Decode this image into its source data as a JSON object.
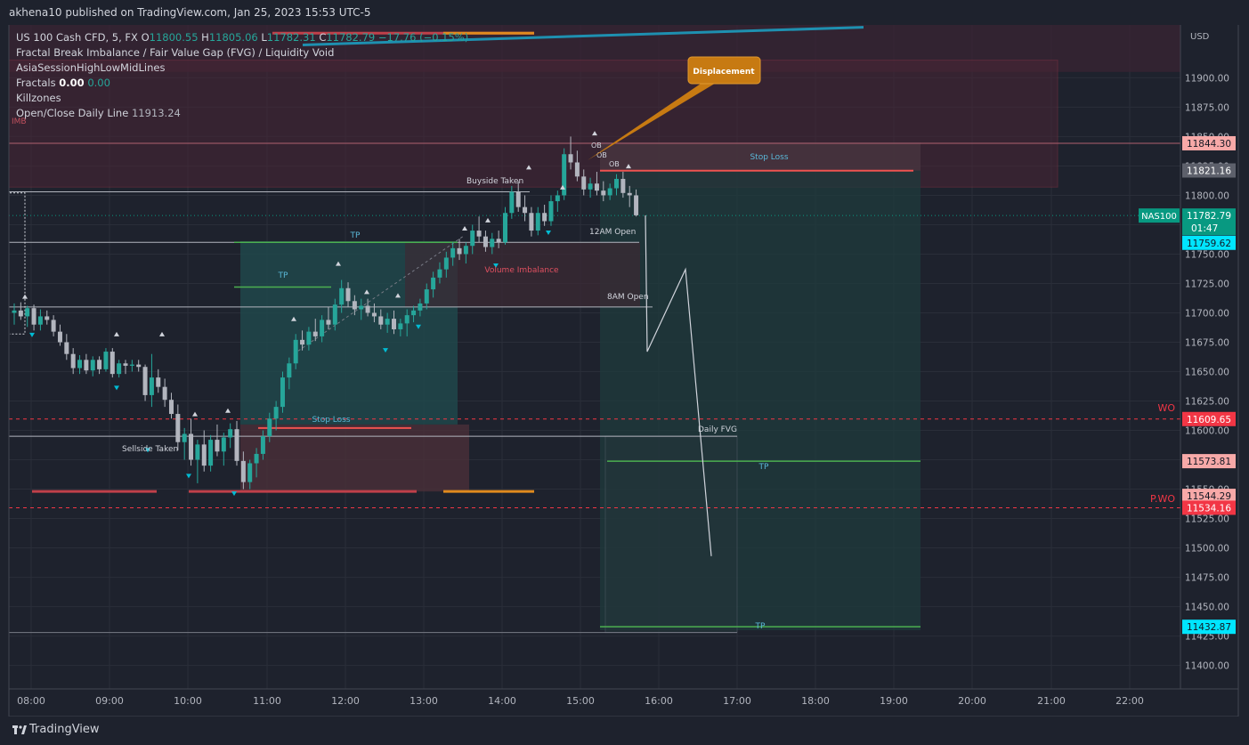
{
  "publisher": "akhena10 published on TradingView.com, Jan 25, 2023 15:53 UTC-5",
  "brand": "TradingView",
  "currency": "USD",
  "legend": {
    "symbol": "US 100 Cash CFD, 5, FX",
    "o_label": "O",
    "o": "11800.55",
    "h_label": "H",
    "h": "11805.06",
    "l_label": "L",
    "l": "11782.31",
    "c_label": "C",
    "c": "11782.79",
    "change": "−17.76 (−0.15%)",
    "ind1": "Fractal Break Imbalance / Fair Value Gap (FVG) / Liquidity Void",
    "ind2": "AsiaSessionHighLowMidLines",
    "ind3": "Fractals",
    "ind3_v1": "0.00",
    "ind3_v2": "0.00",
    "ind4": "Killzones",
    "ind5": "Open/Close Daily Line",
    "ind5_v": "11913.24"
  },
  "colors": {
    "bg": "#1e222d",
    "up": "#26a69a",
    "down": "#ef5350",
    "grid": "#2a2e39",
    "text": "#d1d4dc"
  },
  "chart_data": {
    "type": "candlestick",
    "x_tick_labels": [
      "08:00",
      "09:00",
      "10:00",
      "11:00",
      "12:00",
      "13:00",
      "14:00",
      "15:00",
      "16:00",
      "17:00",
      "18:00",
      "19:00",
      "20:00",
      "21:00",
      "22:00"
    ],
    "y_tick_labels": [
      11400,
      11425,
      11450,
      11475,
      11500,
      11525,
      11550,
      11575,
      11600,
      11625,
      11650,
      11675,
      11700,
      11725,
      11750,
      11775,
      11800,
      11825,
      11850,
      11875,
      11900
    ],
    "ylim": [
      11380,
      11945
    ],
    "price_badges": [
      {
        "label": "11844.30",
        "price": 11844.3,
        "color": "#f7a9a8",
        "text": "#131722"
      },
      {
        "label": "11821.16",
        "price": 11821.16,
        "color": "#5d606b",
        "text": "#ffffff"
      },
      {
        "label": "11782.79",
        "sub": "01:47",
        "price": 11782.79,
        "color": "#089981",
        "text": "#ffffff"
      },
      {
        "label": "11759.62",
        "price": 11759.62,
        "color": "#00e5ff",
        "text": "#131722"
      },
      {
        "label": "11609.65",
        "price": 11609.65,
        "color": "#f23645",
        "text": "#ffffff"
      },
      {
        "label": "11573.81",
        "price": 11573.81,
        "color": "#f7a9a8",
        "text": "#131722"
      },
      {
        "label": "11544.29",
        "price": 11544.29,
        "color": "#f7a9a8",
        "text": "#131722"
      },
      {
        "label": "11534.16",
        "price": 11534.16,
        "color": "#f23645",
        "text": "#ffffff"
      },
      {
        "label": "11432.87",
        "price": 11432.87,
        "color": "#00e5ff",
        "text": "#131722"
      }
    ],
    "symbol_tag": "NAS100",
    "annotations": [
      {
        "text": "Displacement"
      },
      {
        "text": "Stop Loss"
      },
      {
        "text": "TP"
      },
      {
        "text": "TP"
      },
      {
        "text": "Stop Loss"
      },
      {
        "text": "TP"
      },
      {
        "text": "TP"
      },
      {
        "text": "Buyside Taken"
      },
      {
        "text": "Sellside Taken"
      },
      {
        "text": "12AM Open"
      },
      {
        "text": "8AM Open"
      },
      {
        "text": "Volume Imbalance"
      },
      {
        "text": "Daily FVG"
      },
      {
        "text": "IMB"
      },
      {
        "text": "WO"
      },
      {
        "text": "P.WO"
      },
      {
        "text": "OB"
      },
      {
        "text": "OB"
      },
      {
        "text": "OB"
      }
    ],
    "candles": [
      [
        11700,
        11708,
        11690,
        11702
      ],
      [
        11702,
        11709,
        11694,
        11697
      ],
      [
        11697,
        11706,
        11688,
        11704
      ],
      [
        11704,
        11707,
        11685,
        11690
      ],
      [
        11690,
        11703,
        11685,
        11697
      ],
      [
        11697,
        11702,
        11690,
        11694
      ],
      [
        11694,
        11698,
        11680,
        11684
      ],
      [
        11684,
        11690,
        11672,
        11675
      ],
      [
        11675,
        11682,
        11660,
        11665
      ],
      [
        11665,
        11670,
        11648,
        11653
      ],
      [
        11653,
        11664,
        11648,
        11660
      ],
      [
        11660,
        11665,
        11648,
        11651
      ],
      [
        11651,
        11663,
        11646,
        11660
      ],
      [
        11660,
        11663,
        11648,
        11652
      ],
      [
        11652,
        11670,
        11650,
        11667
      ],
      [
        11667,
        11670,
        11645,
        11648
      ],
      [
        11648,
        11660,
        11645,
        11657
      ],
      [
        11657,
        11660,
        11648,
        11655
      ],
      [
        11655,
        11660,
        11650,
        11656
      ],
      [
        11656,
        11660,
        11650,
        11654
      ],
      [
        11654,
        11656,
        11625,
        11630
      ],
      [
        11630,
        11665,
        11620,
        11645
      ],
      [
        11645,
        11652,
        11632,
        11637
      ],
      [
        11637,
        11644,
        11620,
        11626
      ],
      [
        11626,
        11632,
        11610,
        11614
      ],
      [
        11614,
        11622,
        11583,
        11590
      ],
      [
        11590,
        11602,
        11575,
        11597
      ],
      [
        11597,
        11610,
        11570,
        11575
      ],
      [
        11575,
        11592,
        11555,
        11588
      ],
      [
        11588,
        11600,
        11565,
        11570
      ],
      [
        11570,
        11596,
        11565,
        11592
      ],
      [
        11592,
        11605,
        11578,
        11582
      ],
      [
        11582,
        11598,
        11570,
        11594
      ],
      [
        11594,
        11606,
        11585,
        11601
      ],
      [
        11601,
        11608,
        11570,
        11574
      ],
      [
        11574,
        11582,
        11550,
        11556
      ],
      [
        11556,
        11575,
        11550,
        11572
      ],
      [
        11572,
        11585,
        11560,
        11580
      ],
      [
        11580,
        11600,
        11575,
        11595
      ],
      [
        11595,
        11615,
        11590,
        11610
      ],
      [
        11610,
        11625,
        11600,
        11620
      ],
      [
        11620,
        11650,
        11615,
        11645
      ],
      [
        11645,
        11662,
        11635,
        11657
      ],
      [
        11657,
        11682,
        11652,
        11677
      ],
      [
        11677,
        11685,
        11668,
        11673
      ],
      [
        11673,
        11688,
        11668,
        11684
      ],
      [
        11684,
        11695,
        11676,
        11680
      ],
      [
        11680,
        11698,
        11675,
        11694
      ],
      [
        11694,
        11705,
        11686,
        11690
      ],
      [
        11690,
        11712,
        11685,
        11707
      ],
      [
        11707,
        11728,
        11700,
        11721
      ],
      [
        11721,
        11726,
        11705,
        11710
      ],
      [
        11710,
        11715,
        11698,
        11703
      ],
      [
        11703,
        11712,
        11694,
        11706
      ],
      [
        11706,
        11712,
        11697,
        11700
      ],
      [
        11700,
        11708,
        11692,
        11697
      ],
      [
        11697,
        11703,
        11686,
        11690
      ],
      [
        11690,
        11700,
        11683,
        11695
      ],
      [
        11695,
        11702,
        11682,
        11686
      ],
      [
        11686,
        11695,
        11680,
        11691
      ],
      [
        11691,
        11703,
        11680,
        11698
      ],
      [
        11698,
        11706,
        11692,
        11702
      ],
      [
        11702,
        11712,
        11697,
        11708
      ],
      [
        11708,
        11725,
        11703,
        11720
      ],
      [
        11720,
        11735,
        11713,
        11730
      ],
      [
        11730,
        11743,
        11725,
        11737
      ],
      [
        11737,
        11752,
        11730,
        11747
      ],
      [
        11747,
        11760,
        11740,
        11755
      ],
      [
        11755,
        11763,
        11745,
        11750
      ],
      [
        11750,
        11760,
        11742,
        11757
      ],
      [
        11757,
        11775,
        11750,
        11770
      ],
      [
        11770,
        11782,
        11760,
        11765
      ],
      [
        11765,
        11770,
        11752,
        11756
      ],
      [
        11756,
        11768,
        11750,
        11763
      ],
      [
        11763,
        11770,
        11755,
        11760
      ],
      [
        11760,
        11790,
        11758,
        11785
      ],
      [
        11785,
        11808,
        11780,
        11803
      ],
      [
        11803,
        11812,
        11786,
        11790
      ],
      [
        11790,
        11800,
        11778,
        11785
      ],
      [
        11785,
        11790,
        11765,
        11770
      ],
      [
        11770,
        11790,
        11766,
        11785
      ],
      [
        11785,
        11792,
        11774,
        11778
      ],
      [
        11778,
        11800,
        11774,
        11795
      ],
      [
        11795,
        11804,
        11786,
        11800
      ],
      [
        11800,
        11840,
        11796,
        11835
      ],
      [
        11835,
        11850,
        11822,
        11828
      ],
      [
        11828,
        11838,
        11812,
        11816
      ],
      [
        11816,
        11822,
        11800,
        11805
      ],
      [
        11805,
        11815,
        11798,
        11810
      ],
      [
        11810,
        11820,
        11800,
        11804
      ],
      [
        11804,
        11812,
        11795,
        11800
      ],
      [
        11800,
        11810,
        11796,
        11806
      ],
      [
        11806,
        11818,
        11800,
        11814
      ],
      [
        11814,
        11820,
        11798,
        11802
      ],
      [
        11802,
        11808,
        11790,
        11800
      ],
      [
        11800,
        11805,
        11782,
        11783
      ]
    ]
  }
}
